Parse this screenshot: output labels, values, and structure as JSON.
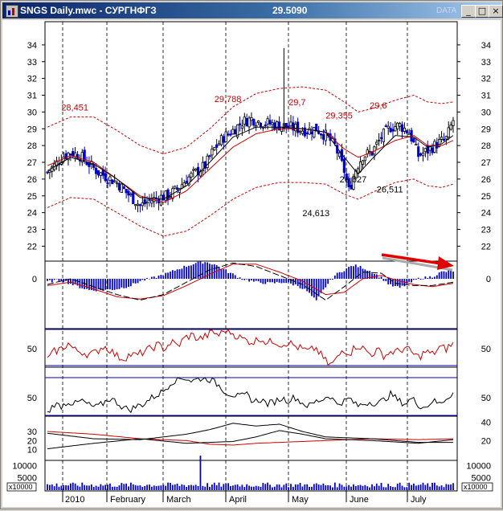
{
  "window": {
    "title": "SNGS Daily.mwc - СУРГНФГЗ",
    "last_price": "29.5090",
    "ghost_label": "DATA",
    "buttons": {
      "minimize": "_",
      "maximize": "□",
      "close": "×"
    }
  },
  "colors": {
    "price_up": "#000000",
    "price_down": "#0000cc",
    "ma_fast": "#000000",
    "ma_slow": "#cc0000",
    "envelope": "#cc0000",
    "macd_hist": "#0000cc",
    "annot_red": "#cc0000",
    "volume": "#0000cc",
    "grid": "#000000"
  },
  "chart_data": [
    {
      "type": "candlestick",
      "panel": "price",
      "ylim": [
        21.3,
        35
      ],
      "yticks": [
        22,
        23,
        24,
        25,
        26,
        27,
        28,
        29,
        30,
        31,
        32,
        33,
        34
      ],
      "x_months": [
        "2010",
        "February",
        "March",
        "April",
        "May",
        "June",
        "July"
      ],
      "close_points": [
        [
          0,
          26.4
        ],
        [
          3,
          26.8
        ],
        [
          6,
          27.3
        ],
        [
          10,
          27.6
        ],
        [
          14,
          27.4
        ],
        [
          18,
          26.9
        ],
        [
          22,
          26.4
        ],
        [
          26,
          26.1
        ],
        [
          30,
          25.8
        ],
        [
          34,
          25.2
        ],
        [
          38,
          24.7
        ],
        [
          40,
          24.4
        ],
        [
          44,
          24.7
        ],
        [
          48,
          24.9
        ],
        [
          52,
          25.0
        ],
        [
          56,
          25.4
        ],
        [
          60,
          26.0
        ],
        [
          64,
          26.4
        ],
        [
          68,
          26.8
        ],
        [
          72,
          27.8
        ],
        [
          76,
          28.5
        ],
        [
          80,
          28.9
        ],
        [
          84,
          29.4
        ],
        [
          88,
          29.6
        ],
        [
          92,
          29.4
        ],
        [
          96,
          29.3
        ],
        [
          100,
          29.2
        ],
        [
          104,
          29.1
        ],
        [
          108,
          29.0
        ],
        [
          112,
          28.9
        ],
        [
          116,
          29.0
        ],
        [
          120,
          28.6
        ],
        [
          124,
          28.0
        ],
        [
          128,
          26.5
        ],
        [
          130,
          25.3
        ],
        [
          133,
          26.6
        ],
        [
          136,
          27.4
        ],
        [
          140,
          27.6
        ],
        [
          144,
          28.5
        ],
        [
          148,
          29.1
        ],
        [
          152,
          29.2
        ],
        [
          156,
          28.8
        ],
        [
          160,
          27.4
        ],
        [
          164,
          27.7
        ],
        [
          168,
          28.1
        ],
        [
          172,
          28.4
        ],
        [
          175,
          29.5
        ]
      ],
      "ma_fast": [
        [
          0,
          26.5
        ],
        [
          10,
          27.3
        ],
        [
          20,
          26.9
        ],
        [
          30,
          26.0
        ],
        [
          40,
          24.9
        ],
        [
          50,
          24.8
        ],
        [
          60,
          25.6
        ],
        [
          70,
          27.0
        ],
        [
          80,
          28.5
        ],
        [
          90,
          29.1
        ],
        [
          100,
          29.1
        ],
        [
          110,
          29.0
        ],
        [
          120,
          28.8
        ],
        [
          128,
          27.3
        ],
        [
          134,
          26.3
        ],
        [
          140,
          27.2
        ],
        [
          150,
          28.6
        ],
        [
          158,
          28.5
        ],
        [
          164,
          27.9
        ],
        [
          170,
          28.1
        ],
        [
          175,
          28.6
        ]
      ],
      "ma_slow": [
        [
          0,
          26.8
        ],
        [
          10,
          27.4
        ],
        [
          20,
          27.0
        ],
        [
          30,
          26.0
        ],
        [
          40,
          25.0
        ],
        [
          50,
          24.6
        ],
        [
          60,
          25.3
        ],
        [
          70,
          26.6
        ],
        [
          80,
          27.9
        ],
        [
          90,
          28.7
        ],
        [
          100,
          29.0
        ],
        [
          110,
          29.0
        ],
        [
          120,
          28.8
        ],
        [
          128,
          27.8
        ],
        [
          134,
          27.3
        ],
        [
          140,
          27.6
        ],
        [
          150,
          28.3
        ],
        [
          158,
          28.6
        ],
        [
          164,
          28.0
        ],
        [
          170,
          28.0
        ],
        [
          175,
          28.3
        ]
      ],
      "envelope_upper": [
        [
          0,
          29.1
        ],
        [
          10,
          29.7
        ],
        [
          20,
          29.7
        ],
        [
          30,
          28.9
        ],
        [
          40,
          28.0
        ],
        [
          50,
          27.5
        ],
        [
          60,
          27.9
        ],
        [
          70,
          29.0
        ],
        [
          80,
          30.3
        ],
        [
          90,
          31.1
        ],
        [
          100,
          31.4
        ],
        [
          110,
          31.5
        ],
        [
          120,
          31.3
        ],
        [
          128,
          30.6
        ],
        [
          134,
          30.0
        ],
        [
          140,
          30.2
        ],
        [
          150,
          30.7
        ],
        [
          158,
          31.0
        ],
        [
          164,
          30.6
        ],
        [
          170,
          30.5
        ],
        [
          175,
          30.6
        ]
      ],
      "envelope_lower": [
        [
          0,
          24.3
        ],
        [
          10,
          24.9
        ],
        [
          20,
          24.8
        ],
        [
          30,
          24.0
        ],
        [
          40,
          23.2
        ],
        [
          50,
          22.6
        ],
        [
          60,
          22.9
        ],
        [
          70,
          23.8
        ],
        [
          80,
          24.8
        ],
        [
          90,
          25.5
        ],
        [
          100,
          25.8
        ],
        [
          110,
          25.8
        ],
        [
          120,
          25.7
        ],
        [
          128,
          25.1
        ],
        [
          134,
          24.8
        ],
        [
          140,
          25.2
        ],
        [
          150,
          25.8
        ],
        [
          158,
          26.0
        ],
        [
          164,
          25.6
        ],
        [
          170,
          25.5
        ],
        [
          175,
          25.7
        ]
      ],
      "annotations": [
        {
          "text": "28,451",
          "x": 6,
          "y": 30.1,
          "color": "red"
        },
        {
          "text": "29,788",
          "x": 72,
          "y": 30.6,
          "color": "red"
        },
        {
          "text": "29,7",
          "x": 104,
          "y": 30.4,
          "color": "red"
        },
        {
          "text": "29,355",
          "x": 120,
          "y": 29.6,
          "color": "red"
        },
        {
          "text": "29,6",
          "x": 139,
          "y": 30.2,
          "color": "red"
        },
        {
          "text": "24,613",
          "x": 110,
          "y": 23.8,
          "color": "black"
        },
        {
          "text": "26,627",
          "x": 126,
          "y": 25.8,
          "color": "black"
        },
        {
          "text": "26,511",
          "x": 142,
          "y": 25.2,
          "color": "black"
        }
      ]
    },
    {
      "type": "histogram+lines",
      "panel": "macd",
      "zero_label": "0",
      "hist_points": [
        [
          0,
          -0.25
        ],
        [
          6,
          -0.1
        ],
        [
          12,
          -0.6
        ],
        [
          18,
          -1.0
        ],
        [
          24,
          -1.0
        ],
        [
          30,
          -0.9
        ],
        [
          36,
          -0.6
        ],
        [
          40,
          -0.2
        ],
        [
          46,
          0.1
        ],
        [
          52,
          0.5
        ],
        [
          58,
          1.0
        ],
        [
          64,
          1.4
        ],
        [
          68,
          1.5
        ],
        [
          72,
          1.3
        ],
        [
          78,
          0.6
        ],
        [
          84,
          0.0
        ],
        [
          90,
          -0.3
        ],
        [
          96,
          -0.4
        ],
        [
          102,
          -0.3
        ],
        [
          108,
          -0.6
        ],
        [
          112,
          -1.1
        ],
        [
          116,
          -2.0
        ],
        [
          120,
          -0.7
        ],
        [
          124,
          0.3
        ],
        [
          128,
          0.8
        ],
        [
          132,
          1.2
        ],
        [
          136,
          1.0
        ],
        [
          140,
          0.6
        ],
        [
          144,
          0.1
        ],
        [
          148,
          -0.6
        ],
        [
          152,
          -0.8
        ],
        [
          156,
          -0.4
        ],
        [
          160,
          0.0
        ],
        [
          166,
          0.2
        ],
        [
          170,
          0.6
        ],
        [
          175,
          0.7
        ]
      ],
      "signal_black": [
        [
          0,
          -0.5
        ],
        [
          10,
          0.0
        ],
        [
          20,
          -0.7
        ],
        [
          30,
          -1.4
        ],
        [
          40,
          -1.9
        ],
        [
          50,
          -1.4
        ],
        [
          60,
          -0.3
        ],
        [
          70,
          0.8
        ],
        [
          80,
          1.4
        ],
        [
          90,
          1.1
        ],
        [
          100,
          0.3
        ],
        [
          110,
          -0.5
        ],
        [
          120,
          -1.9
        ],
        [
          128,
          -0.7
        ],
        [
          136,
          0.6
        ],
        [
          144,
          0.5
        ],
        [
          150,
          -0.4
        ],
        [
          158,
          -0.6
        ],
        [
          166,
          -0.6
        ],
        [
          175,
          -0.3
        ]
      ],
      "signal_red": [
        [
          0,
          -0.6
        ],
        [
          10,
          -0.3
        ],
        [
          20,
          -0.9
        ],
        [
          30,
          -1.6
        ],
        [
          40,
          -1.8
        ],
        [
          50,
          -1.5
        ],
        [
          60,
          -0.6
        ],
        [
          70,
          0.4
        ],
        [
          80,
          1.3
        ],
        [
          90,
          1.3
        ],
        [
          100,
          0.6
        ],
        [
          110,
          -0.2
        ],
        [
          120,
          -1.4
        ],
        [
          128,
          -1.2
        ],
        [
          136,
          0.0
        ],
        [
          144,
          0.3
        ],
        [
          150,
          -0.1
        ],
        [
          158,
          -0.5
        ],
        [
          166,
          -0.7
        ],
        [
          175,
          -0.4
        ]
      ]
    },
    {
      "type": "line",
      "panel": "oscillator_red",
      "level_label": "50",
      "values": [
        44,
        50,
        52,
        56,
        51,
        50,
        48,
        49,
        54,
        52,
        47,
        45,
        48,
        47,
        50,
        52,
        55,
        52,
        57,
        54,
        60,
        62,
        59,
        61,
        64,
        62,
        66,
        63,
        60,
        58,
        57,
        60,
        56,
        58,
        55,
        57,
        54,
        52,
        50,
        53,
        46,
        40,
        44,
        52,
        49,
        55,
        52,
        48,
        51,
        47,
        50,
        50,
        53,
        49,
        46,
        50,
        48,
        53,
        52,
        56
      ]
    },
    {
      "type": "line",
      "panel": "oscillator_black",
      "level_label": "50",
      "values": [
        42,
        50,
        48,
        52,
        50,
        53,
        49,
        47,
        50,
        55,
        52,
        47,
        45,
        48,
        50,
        55,
        58,
        62,
        69,
        72,
        73,
        70,
        72,
        73,
        70,
        66,
        60,
        58,
        56,
        58,
        52,
        54,
        50,
        52,
        55,
        53,
        56,
        51,
        48,
        52,
        54,
        58,
        50,
        52,
        55,
        48,
        50,
        52,
        50,
        54,
        59,
        53,
        50,
        55,
        49,
        47,
        53,
        50,
        55,
        60
      ]
    },
    {
      "type": "line",
      "panel": "directional",
      "left_ticks": [
        "30",
        "20",
        "10"
      ],
      "right_ticks": [
        "40",
        "20"
      ],
      "series_black_a": [
        [
          0,
          28
        ],
        [
          20,
          22
        ],
        [
          40,
          21
        ],
        [
          60,
          27
        ],
        [
          70,
          32
        ],
        [
          80,
          39
        ],
        [
          90,
          36
        ],
        [
          100,
          38
        ],
        [
          110,
          30
        ],
        [
          120,
          24
        ],
        [
          140,
          22
        ],
        [
          160,
          18
        ],
        [
          175,
          18
        ]
      ],
      "series_black_b": [
        [
          0,
          11
        ],
        [
          20,
          17
        ],
        [
          40,
          22
        ],
        [
          60,
          17
        ],
        [
          70,
          18
        ],
        [
          80,
          19
        ],
        [
          90,
          24
        ],
        [
          100,
          31
        ],
        [
          110,
          27
        ],
        [
          120,
          22
        ],
        [
          140,
          20
        ],
        [
          160,
          17
        ],
        [
          175,
          21
        ]
      ],
      "series_red": [
        [
          0,
          30
        ],
        [
          20,
          27
        ],
        [
          40,
          22
        ],
        [
          60,
          20
        ],
        [
          70,
          16
        ],
        [
          80,
          15
        ],
        [
          90,
          17
        ],
        [
          100,
          18
        ],
        [
          110,
          19
        ],
        [
          120,
          20
        ],
        [
          140,
          22
        ],
        [
          160,
          21
        ],
        [
          175,
          22
        ]
      ]
    },
    {
      "type": "bar",
      "panel": "volume",
      "left_ticks": [
        "10000",
        "5000"
      ],
      "right_ticks": [
        "10000",
        "5000"
      ],
      "multiplier_label": "x10000",
      "spike_index": 66,
      "spike_value": 14000,
      "typical_value": 2200
    }
  ]
}
